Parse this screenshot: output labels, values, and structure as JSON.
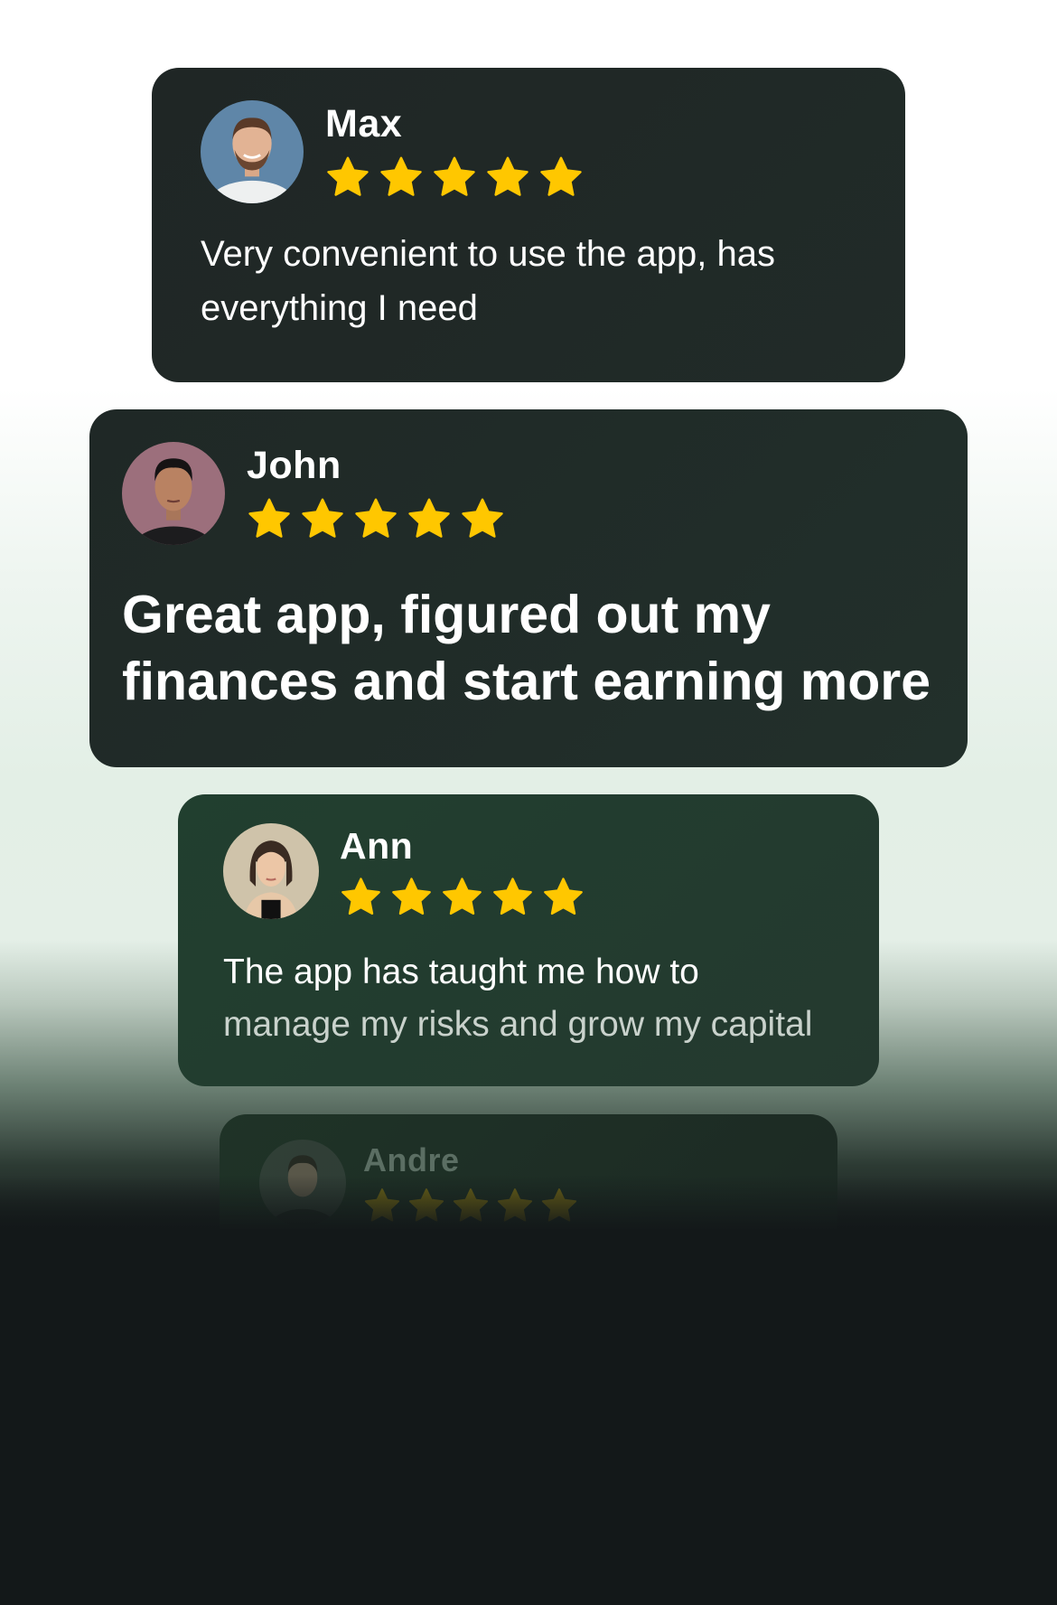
{
  "colors": {
    "star": "#FFC700",
    "card_text": "#FFFFFF",
    "page_bottom": "#131819"
  },
  "reviews": [
    {
      "name": "Max",
      "rating": 5,
      "avatar_icon": "avatar-man-smiling-icon",
      "lines": [
        "Very convenient to use the app, has",
        "everything I need"
      ]
    },
    {
      "name": "John",
      "rating": 5,
      "avatar_icon": "avatar-man-portrait-icon",
      "lines": [
        "Great app, figured out my",
        "finances and start earning more"
      ]
    },
    {
      "name": "Ann",
      "rating": 5,
      "avatar_icon": "avatar-woman-portrait-icon",
      "lines": [
        "The app has taught me how to",
        "manage  my risks and grow my capital"
      ]
    },
    {
      "name": "Andre",
      "rating": 5,
      "avatar_icon": "avatar-man-dark-icon",
      "lines": []
    }
  ]
}
